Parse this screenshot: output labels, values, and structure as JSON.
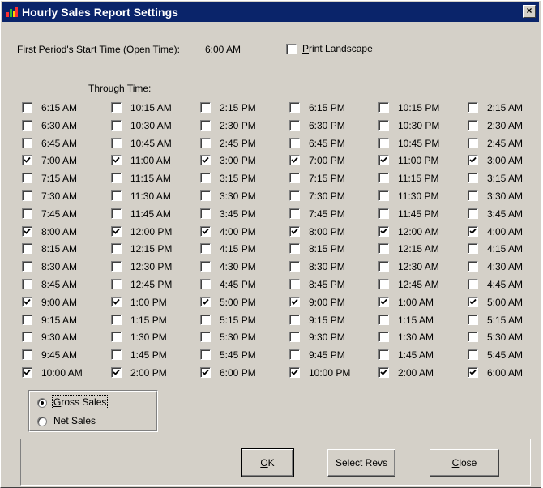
{
  "window": {
    "title": "Hourly Sales Report Settings",
    "close_label": "×"
  },
  "header": {
    "start_time_label": "First Period's Start Time (Open Time):",
    "start_time_value": "6:00 AM",
    "print_landscape": {
      "label_prefix": "",
      "label_underlined": "P",
      "label_rest": "rint Landscape",
      "checked": false
    }
  },
  "through_time_label": "Through Time:",
  "times": [
    [
      {
        "t": "6:15 AM",
        "c": false
      },
      {
        "t": "6:30 AM",
        "c": false
      },
      {
        "t": "6:45 AM",
        "c": false
      },
      {
        "t": "7:00 AM",
        "c": true
      },
      {
        "t": "7:15 AM",
        "c": false
      },
      {
        "t": "7:30 AM",
        "c": false
      },
      {
        "t": "7:45 AM",
        "c": false
      },
      {
        "t": "8:00 AM",
        "c": true
      },
      {
        "t": "8:15 AM",
        "c": false
      },
      {
        "t": "8:30 AM",
        "c": false
      },
      {
        "t": "8:45 AM",
        "c": false
      },
      {
        "t": "9:00 AM",
        "c": true
      },
      {
        "t": "9:15 AM",
        "c": false
      },
      {
        "t": "9:30 AM",
        "c": false
      },
      {
        "t": "9:45 AM",
        "c": false
      },
      {
        "t": "10:00 AM",
        "c": true
      }
    ],
    [
      {
        "t": "10:15 AM",
        "c": false
      },
      {
        "t": "10:30 AM",
        "c": false
      },
      {
        "t": "10:45 AM",
        "c": false
      },
      {
        "t": "11:00 AM",
        "c": true
      },
      {
        "t": "11:15 AM",
        "c": false
      },
      {
        "t": "11:30 AM",
        "c": false
      },
      {
        "t": "11:45 AM",
        "c": false
      },
      {
        "t": "12:00 PM",
        "c": true
      },
      {
        "t": "12:15 PM",
        "c": false
      },
      {
        "t": "12:30 PM",
        "c": false
      },
      {
        "t": "12:45 PM",
        "c": false
      },
      {
        "t": "1:00 PM",
        "c": true
      },
      {
        "t": "1:15 PM",
        "c": false
      },
      {
        "t": "1:30 PM",
        "c": false
      },
      {
        "t": "1:45 PM",
        "c": false
      },
      {
        "t": "2:00 PM",
        "c": true
      }
    ],
    [
      {
        "t": "2:15 PM",
        "c": false
      },
      {
        "t": "2:30 PM",
        "c": false
      },
      {
        "t": "2:45 PM",
        "c": false
      },
      {
        "t": "3:00 PM",
        "c": true
      },
      {
        "t": "3:15 PM",
        "c": false
      },
      {
        "t": "3:30 PM",
        "c": false
      },
      {
        "t": "3:45 PM",
        "c": false
      },
      {
        "t": "4:00 PM",
        "c": true
      },
      {
        "t": "4:15 PM",
        "c": false
      },
      {
        "t": "4:30 PM",
        "c": false
      },
      {
        "t": "4:45 PM",
        "c": false
      },
      {
        "t": "5:00 PM",
        "c": true
      },
      {
        "t": "5:15 PM",
        "c": false
      },
      {
        "t": "5:30 PM",
        "c": false
      },
      {
        "t": "5:45 PM",
        "c": false
      },
      {
        "t": "6:00 PM",
        "c": true
      }
    ],
    [
      {
        "t": "6:15 PM",
        "c": false
      },
      {
        "t": "6:30 PM",
        "c": false
      },
      {
        "t": "6:45 PM",
        "c": false
      },
      {
        "t": "7:00 PM",
        "c": true
      },
      {
        "t": "7:15 PM",
        "c": false
      },
      {
        "t": "7:30 PM",
        "c": false
      },
      {
        "t": "7:45 PM",
        "c": false
      },
      {
        "t": "8:00 PM",
        "c": true
      },
      {
        "t": "8:15 PM",
        "c": false
      },
      {
        "t": "8:30 PM",
        "c": false
      },
      {
        "t": "8:45 PM",
        "c": false
      },
      {
        "t": "9:00 PM",
        "c": true
      },
      {
        "t": "9:15 PM",
        "c": false
      },
      {
        "t": "9:30 PM",
        "c": false
      },
      {
        "t": "9:45 PM",
        "c": false
      },
      {
        "t": "10:00 PM",
        "c": true
      }
    ],
    [
      {
        "t": "10:15 PM",
        "c": false
      },
      {
        "t": "10:30 PM",
        "c": false
      },
      {
        "t": "10:45 PM",
        "c": false
      },
      {
        "t": "11:00 PM",
        "c": true
      },
      {
        "t": "11:15 PM",
        "c": false
      },
      {
        "t": "11:30 PM",
        "c": false
      },
      {
        "t": "11:45 PM",
        "c": false
      },
      {
        "t": "12:00 AM",
        "c": true
      },
      {
        "t": "12:15 AM",
        "c": false
      },
      {
        "t": "12:30 AM",
        "c": false
      },
      {
        "t": "12:45 AM",
        "c": false
      },
      {
        "t": "1:00 AM",
        "c": true
      },
      {
        "t": "1:15 AM",
        "c": false
      },
      {
        "t": "1:30 AM",
        "c": false
      },
      {
        "t": "1:45 AM",
        "c": false
      },
      {
        "t": "2:00 AM",
        "c": true
      }
    ],
    [
      {
        "t": "2:15 AM",
        "c": false
      },
      {
        "t": "2:30 AM",
        "c": false
      },
      {
        "t": "2:45 AM",
        "c": false
      },
      {
        "t": "3:00 AM",
        "c": true
      },
      {
        "t": "3:15 AM",
        "c": false
      },
      {
        "t": "3:30 AM",
        "c": false
      },
      {
        "t": "3:45 AM",
        "c": false
      },
      {
        "t": "4:00 AM",
        "c": true
      },
      {
        "t": "4:15 AM",
        "c": false
      },
      {
        "t": "4:30 AM",
        "c": false
      },
      {
        "t": "4:45 AM",
        "c": false
      },
      {
        "t": "5:00 AM",
        "c": true
      },
      {
        "t": "5:15 AM",
        "c": false
      },
      {
        "t": "5:30 AM",
        "c": false
      },
      {
        "t": "5:45 AM",
        "c": false
      },
      {
        "t": "6:00 AM",
        "c": true
      }
    ]
  ],
  "sales_type": {
    "gross": {
      "u": "G",
      "rest": "ross Sales",
      "selected": true
    },
    "net": {
      "u": "",
      "rest": "Net Sales",
      "selected": false
    }
  },
  "buttons": {
    "ok": {
      "u": "O",
      "rest": "K"
    },
    "select_revs": "Select Revs",
    "close": {
      "u": "C",
      "rest": "lose"
    }
  },
  "colors": {
    "titlebar": "#0a246a",
    "face": "#d4d0c8"
  },
  "icons": {
    "app": "app-icon",
    "close": "close-icon",
    "check": "check-icon"
  }
}
